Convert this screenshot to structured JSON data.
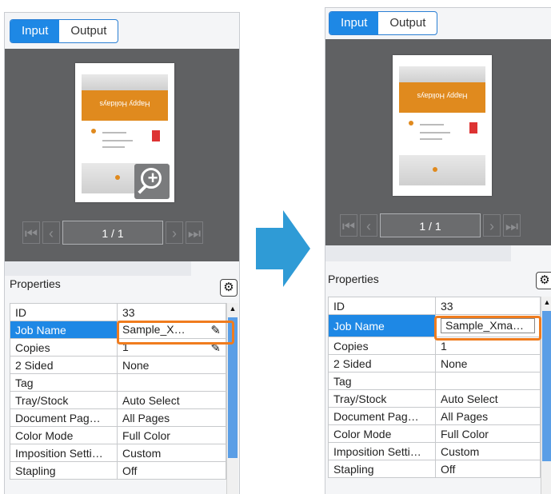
{
  "tabs": {
    "input": "Input",
    "output": "Output"
  },
  "preview": {
    "page_indicator": "1 / 1",
    "thumbnail_text": "Happy Holidays",
    "nav_icons": [
      "first-page-icon",
      "prev-page-icon",
      "next-page-icon",
      "last-page-icon"
    ]
  },
  "properties": {
    "title": "Properties",
    "rows": [
      {
        "key": "ID",
        "value": "33"
      },
      {
        "key": "Job Name",
        "value": "Sample_X…"
      },
      {
        "key": "Copies",
        "value": "1"
      },
      {
        "key": "2 Sided",
        "value": "None"
      },
      {
        "key": "Tag",
        "value": ""
      },
      {
        "key": "Tray/Stock",
        "value": "Auto Select"
      },
      {
        "key": "Document Pag…",
        "value": "All Pages"
      },
      {
        "key": "Color Mode",
        "value": "Full Color"
      },
      {
        "key": "Imposition Setti…",
        "value": "Custom"
      },
      {
        "key": "Stapling",
        "value": "Off"
      }
    ],
    "job_name_editing_value": "Sample_Xma…"
  },
  "colors": {
    "accent": "#1e88e5",
    "highlight": "#f07c1e",
    "transition_arrow": "#2f9bd6",
    "preview_bg": "#606163"
  }
}
